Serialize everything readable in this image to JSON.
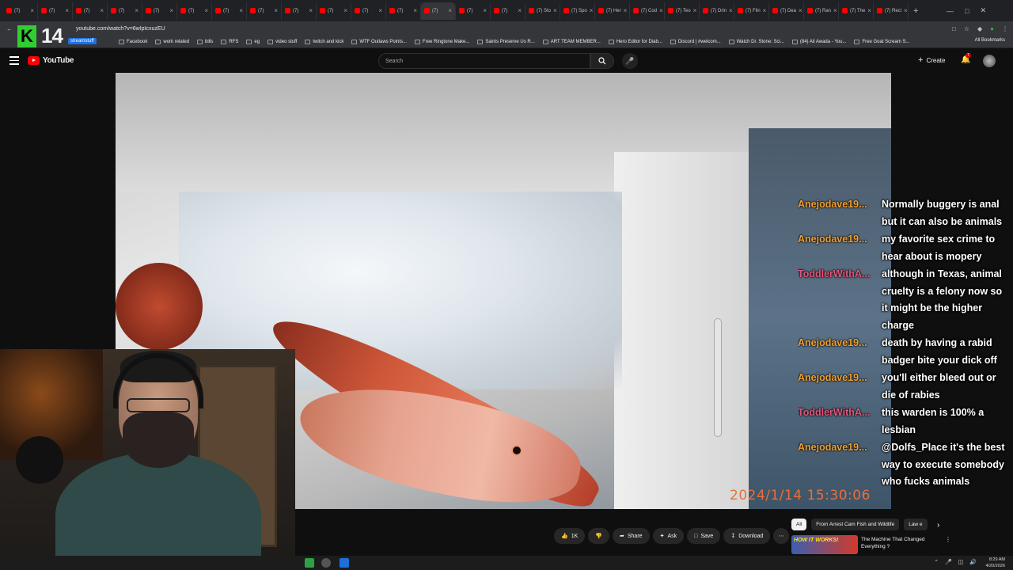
{
  "browser": {
    "tabs": [
      {
        "label": "(7)"
      },
      {
        "label": "(7)"
      },
      {
        "label": "(7)"
      },
      {
        "label": "(7)"
      },
      {
        "label": "(7)"
      },
      {
        "label": "(7)"
      },
      {
        "label": "(7)"
      },
      {
        "label": "(7)"
      },
      {
        "label": "(7)"
      },
      {
        "label": "(7)"
      },
      {
        "label": "(7)"
      },
      {
        "label": "(7)"
      },
      {
        "label": "(7)"
      },
      {
        "label": "(7)"
      },
      {
        "label": "(7)"
      },
      {
        "label": "(7) Sto"
      },
      {
        "label": "(7) Spo"
      },
      {
        "label": "(7) Her"
      },
      {
        "label": "(7) Cod"
      },
      {
        "label": "(7) Teo"
      },
      {
        "label": "(7) Drin"
      },
      {
        "label": "(7) Flin"
      },
      {
        "label": "(7) Dea"
      },
      {
        "label": "(7) Ran"
      },
      {
        "label": "(7) The"
      },
      {
        "label": "(7) Reci"
      }
    ],
    "new_tab": "+",
    "url": "youtube.com/watch?v=6wIpIcxuzEU",
    "bookmarks": [
      "Facebook",
      "work related",
      "bills",
      "RFS",
      "eg",
      "video stuff",
      "twitch and kick",
      "WTF Outlaws Points...",
      "Free Ringtone Make...",
      "Saints Preserve Us R...",
      "ART TEAM MEMBER...",
      "Hero Editor for Diab...",
      "Discord | #welcom...",
      "Watch Dr. Stone: Sci...",
      "(84) Ali Awada - You...",
      "Free Goat Scream S..."
    ],
    "all_bookmarks": "All Bookmarks"
  },
  "overlay": {
    "logo_k": "K",
    "logo_num": "14",
    "streamstuff": "streamstuff",
    "timestamp": "2024/1/14  15:30:06"
  },
  "youtube": {
    "logo": "YouTube",
    "search_placeholder": "Search",
    "create": "Create",
    "notif_count": "7",
    "actions": {
      "like": "1K",
      "share": "Share",
      "ask": "Ask",
      "save": "Save",
      "download": "Download"
    },
    "chips": [
      "All",
      "From Arrest Cam Fish and Wildlife",
      "Law e"
    ],
    "recommended": {
      "thumb_text": "HOW IT WORKS!",
      "title": "The Machine That Changed Everything ?"
    }
  },
  "chat": [
    {
      "user": "Anejodave19...",
      "color": "#f0a030",
      "text": "Normally buggery is anal but it can also be animals"
    },
    {
      "user": "Anejodave19...",
      "color": "#f0a030",
      "text": "my favorite sex crime to hear about is mopery"
    },
    {
      "user": "ToddlerWithA...",
      "color": "#e0567a",
      "text": "although in Texas, animal cruelty is a felony now so it might be the higher charge"
    },
    {
      "user": "Anejodave19...",
      "color": "#f0a030",
      "text": "death by having a rabid badger bite your dick off"
    },
    {
      "user": "Anejodave19...",
      "color": "#f0a030",
      "text": "you'll either bleed out or die of rabies"
    },
    {
      "user": "ToddlerWithA...",
      "color": "#e0567a",
      "text": "this warden is 100% a lesbian"
    },
    {
      "user": "Anejodave19...",
      "color": "#f0a030",
      "text": "@Dolfs_Place it's the best way to execute somebody who fucks animals"
    }
  ],
  "taskbar": {
    "time": "8:29 AM",
    "date": "4/20/2026"
  }
}
